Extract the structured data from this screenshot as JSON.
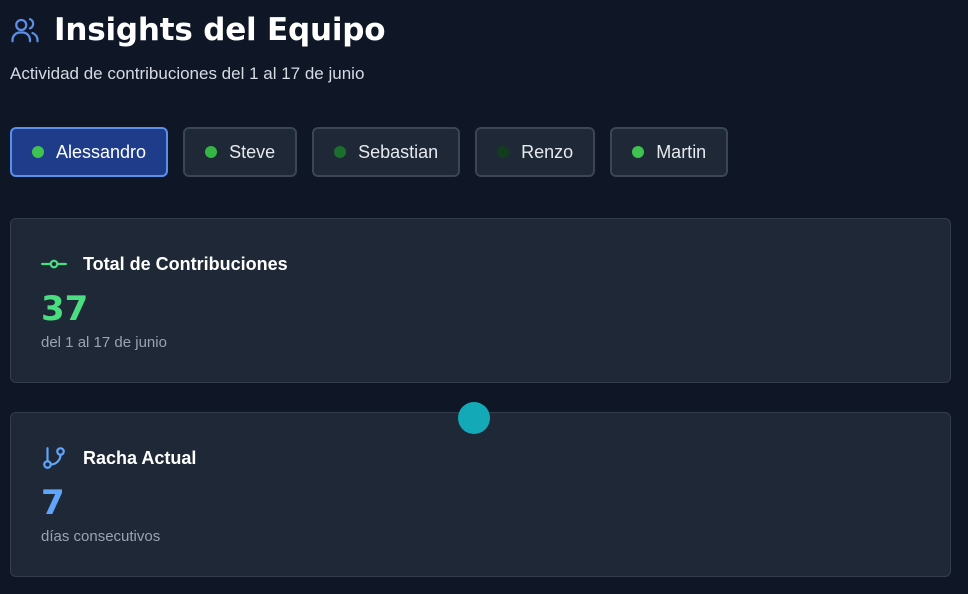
{
  "header": {
    "title": "Insights del Equipo",
    "subtitle": "Actividad de contribuciones del 1 al 17 de junio",
    "icon": "users-icon",
    "icon_color": "#5b8fe8"
  },
  "members": [
    {
      "name": "Alessandro",
      "dot_color": "#3fc350",
      "selected": true
    },
    {
      "name": "Steve",
      "dot_color": "#35b544",
      "selected": false
    },
    {
      "name": "Sebastian",
      "dot_color": "#1c6e2c",
      "selected": false
    },
    {
      "name": "Renzo",
      "dot_color": "#113d1e",
      "selected": false
    },
    {
      "name": "Martin",
      "dot_color": "#3fc350",
      "selected": false
    }
  ],
  "stats": {
    "total": {
      "icon": "git-commit-icon",
      "label": "Total de Contribuciones",
      "value": "37",
      "note": "del 1 al 17 de junio",
      "color": "#4ade80"
    },
    "streak": {
      "icon": "git-branch-icon",
      "label": "Racha Actual",
      "value": "7",
      "note": "días consecutivos",
      "color": "#60a5fa"
    }
  },
  "colors": {
    "background": "#0f1727",
    "card": "#1f2837",
    "accent": "#5b8fe8",
    "pointer": "#14a9b7"
  }
}
